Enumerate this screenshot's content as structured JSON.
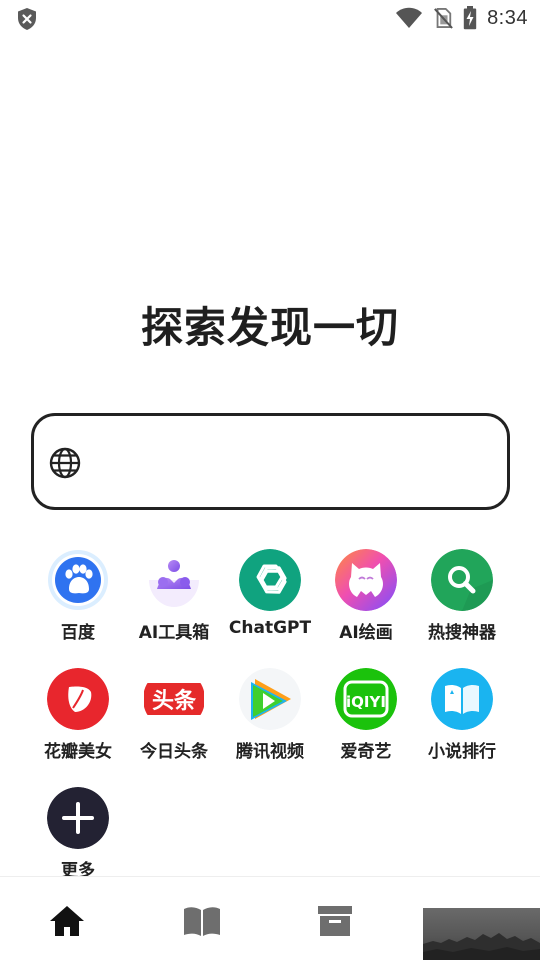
{
  "status_bar": {
    "time": "8:34",
    "icons": [
      "shield-x-icon",
      "wifi-icon",
      "no-sim-icon",
      "battery-charging-icon"
    ]
  },
  "headline": "探索发现一切",
  "search": {
    "icon": "globe-icon",
    "value": "",
    "placeholder": ""
  },
  "apps": [
    {
      "label": "百度",
      "icon": "baidu-paw-icon"
    },
    {
      "label": "AI工具箱",
      "icon": "ai-toolbox-icon"
    },
    {
      "label": "ChatGPT",
      "icon": "chatgpt-icon"
    },
    {
      "label": "AI绘画",
      "icon": "ai-paint-icon"
    },
    {
      "label": "热搜神器",
      "icon": "hot-search-icon"
    },
    {
      "label": "花瓣美女",
      "icon": "huaban-icon"
    },
    {
      "label": "今日头条",
      "icon": "toutiao-icon"
    },
    {
      "label": "腾讯视频",
      "icon": "tencent-video-icon"
    },
    {
      "label": "爱奇艺",
      "icon": "iqiyi-icon"
    },
    {
      "label": "小说排行",
      "icon": "novel-book-icon"
    },
    {
      "label": "更多",
      "icon": "plus-icon"
    }
  ],
  "bottom_nav": {
    "items": [
      "home-icon",
      "book-icon",
      "archive-box-icon"
    ],
    "active": "home-icon"
  },
  "colors": {
    "headline": "#1f1f1f",
    "search_border": "#222222",
    "chatgpt": "#10a37f",
    "hot_search": "#21a55a",
    "huaban": "#e8262d",
    "toutiao": "#e52a2a",
    "iqiyi": "#1bc20c",
    "novel": "#1ab4f0",
    "more": "#232233",
    "nav_active": "#111111",
    "nav_inactive": "#6e6e6e"
  }
}
